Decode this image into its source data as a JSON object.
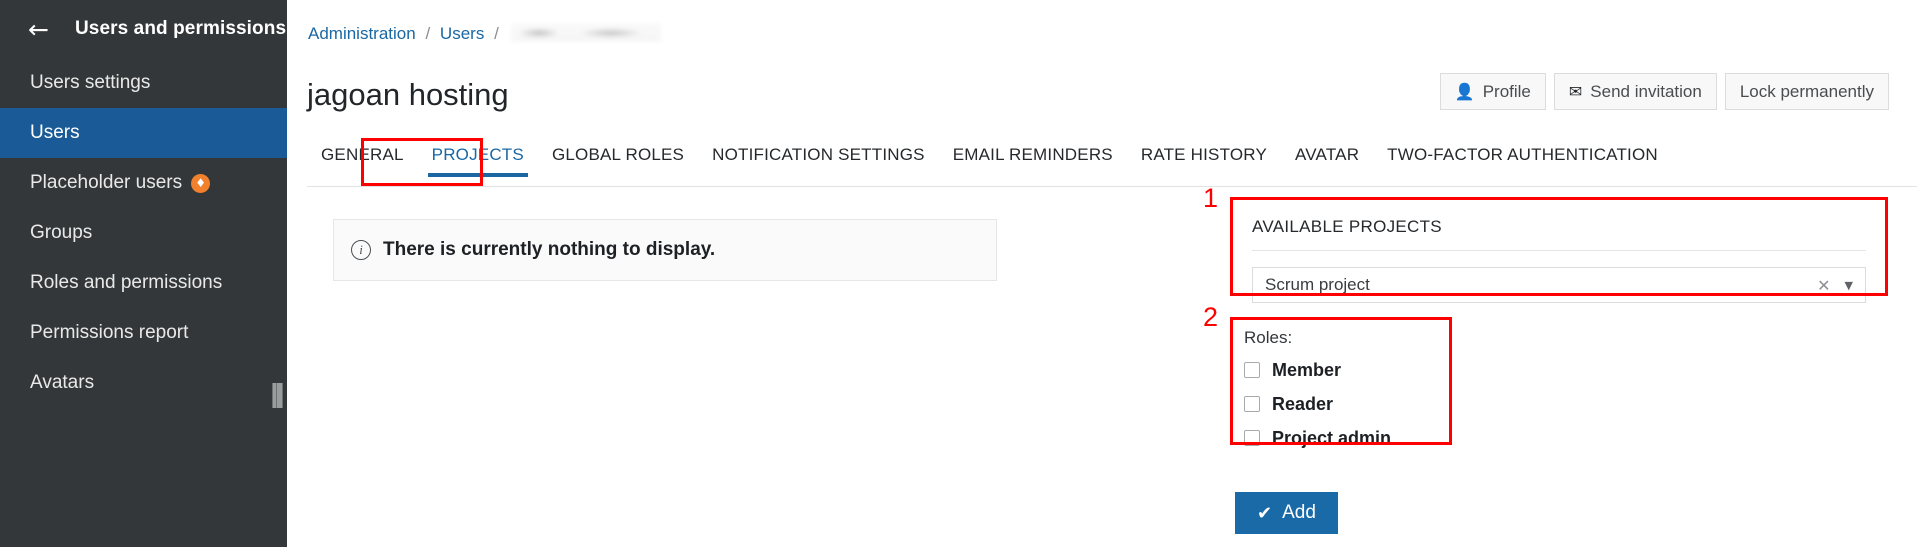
{
  "sidebar": {
    "back_icon": "arrow-left-icon",
    "title": "Users and permissions",
    "items": [
      {
        "label": "Users settings",
        "selected": false,
        "badge": null
      },
      {
        "label": "Users",
        "selected": true,
        "badge": null
      },
      {
        "label": "Placeholder users",
        "selected": false,
        "badge": "♦"
      },
      {
        "label": "Groups",
        "selected": false,
        "badge": null
      },
      {
        "label": "Roles and permissions",
        "selected": false,
        "badge": null
      },
      {
        "label": "Permissions report",
        "selected": false,
        "badge": null
      },
      {
        "label": "Avatars",
        "selected": false,
        "badge": null
      }
    ],
    "selected_bg": "#1a5a96",
    "bg": "#333739"
  },
  "breadcrumb": {
    "administration": "Administration",
    "users": "Users",
    "separator": "/",
    "current_redacted": ""
  },
  "page": {
    "title": "jagoan hosting"
  },
  "top_actions": [
    {
      "label": "Profile",
      "icon": "person-icon",
      "glyph": "👤"
    },
    {
      "label": "Send invitation",
      "icon": "envelope-icon",
      "glyph": "✉"
    },
    {
      "label": "Lock permanently",
      "icon": null,
      "glyph": ""
    }
  ],
  "tabs": [
    {
      "label": "GENERAL",
      "active": false
    },
    {
      "label": "PROJECTS",
      "active": true
    },
    {
      "label": "GLOBAL ROLES",
      "active": false
    },
    {
      "label": "NOTIFICATION SETTINGS",
      "active": false
    },
    {
      "label": "EMAIL REMINDERS",
      "active": false
    },
    {
      "label": "RATE HISTORY",
      "active": false
    },
    {
      "label": "AVATAR",
      "active": false
    },
    {
      "label": "TWO-FACTOR AUTHENTICATION",
      "active": false
    }
  ],
  "empty_state": {
    "icon": "info-icon",
    "glyph": "i",
    "text": "There is currently nothing to display."
  },
  "available_projects": {
    "section_label": "AVAILABLE PROJECTS",
    "select_value": "Scrum project",
    "clear_glyph": "✕",
    "caret_glyph": "▼"
  },
  "roles": {
    "label": "Roles:",
    "items": [
      {
        "label": "Member",
        "checked": false
      },
      {
        "label": "Reader",
        "checked": false
      },
      {
        "label": "Project admin",
        "checked": false
      }
    ]
  },
  "add_button": {
    "label": "Add",
    "glyph": "✔",
    "color": "#1a6aa8"
  },
  "annotations": [
    {
      "number": "1",
      "target": "available-projects-panel",
      "color": "#ff0000"
    },
    {
      "number": "2",
      "target": "roles-panel",
      "color": "#ff0000"
    },
    {
      "number": "",
      "target": "projects-tab",
      "color": "#ff0000"
    }
  ]
}
